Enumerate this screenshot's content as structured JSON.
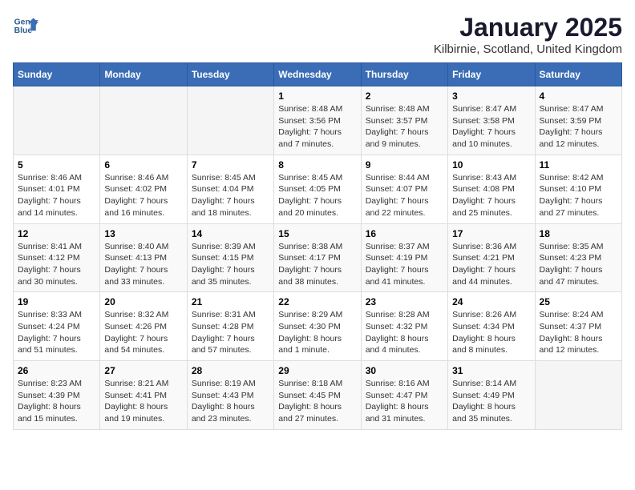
{
  "header": {
    "logo_line1": "General",
    "logo_line2": "Blue",
    "title": "January 2025",
    "subtitle": "Kilbirnie, Scotland, United Kingdom"
  },
  "days_of_week": [
    "Sunday",
    "Monday",
    "Tuesday",
    "Wednesday",
    "Thursday",
    "Friday",
    "Saturday"
  ],
  "weeks": [
    [
      {
        "day": "",
        "info": ""
      },
      {
        "day": "",
        "info": ""
      },
      {
        "day": "",
        "info": ""
      },
      {
        "day": "1",
        "info": "Sunrise: 8:48 AM\nSunset: 3:56 PM\nDaylight: 7 hours\nand 7 minutes."
      },
      {
        "day": "2",
        "info": "Sunrise: 8:48 AM\nSunset: 3:57 PM\nDaylight: 7 hours\nand 9 minutes."
      },
      {
        "day": "3",
        "info": "Sunrise: 8:47 AM\nSunset: 3:58 PM\nDaylight: 7 hours\nand 10 minutes."
      },
      {
        "day": "4",
        "info": "Sunrise: 8:47 AM\nSunset: 3:59 PM\nDaylight: 7 hours\nand 12 minutes."
      }
    ],
    [
      {
        "day": "5",
        "info": "Sunrise: 8:46 AM\nSunset: 4:01 PM\nDaylight: 7 hours\nand 14 minutes."
      },
      {
        "day": "6",
        "info": "Sunrise: 8:46 AM\nSunset: 4:02 PM\nDaylight: 7 hours\nand 16 minutes."
      },
      {
        "day": "7",
        "info": "Sunrise: 8:45 AM\nSunset: 4:04 PM\nDaylight: 7 hours\nand 18 minutes."
      },
      {
        "day": "8",
        "info": "Sunrise: 8:45 AM\nSunset: 4:05 PM\nDaylight: 7 hours\nand 20 minutes."
      },
      {
        "day": "9",
        "info": "Sunrise: 8:44 AM\nSunset: 4:07 PM\nDaylight: 7 hours\nand 22 minutes."
      },
      {
        "day": "10",
        "info": "Sunrise: 8:43 AM\nSunset: 4:08 PM\nDaylight: 7 hours\nand 25 minutes."
      },
      {
        "day": "11",
        "info": "Sunrise: 8:42 AM\nSunset: 4:10 PM\nDaylight: 7 hours\nand 27 minutes."
      }
    ],
    [
      {
        "day": "12",
        "info": "Sunrise: 8:41 AM\nSunset: 4:12 PM\nDaylight: 7 hours\nand 30 minutes."
      },
      {
        "day": "13",
        "info": "Sunrise: 8:40 AM\nSunset: 4:13 PM\nDaylight: 7 hours\nand 33 minutes."
      },
      {
        "day": "14",
        "info": "Sunrise: 8:39 AM\nSunset: 4:15 PM\nDaylight: 7 hours\nand 35 minutes."
      },
      {
        "day": "15",
        "info": "Sunrise: 8:38 AM\nSunset: 4:17 PM\nDaylight: 7 hours\nand 38 minutes."
      },
      {
        "day": "16",
        "info": "Sunrise: 8:37 AM\nSunset: 4:19 PM\nDaylight: 7 hours\nand 41 minutes."
      },
      {
        "day": "17",
        "info": "Sunrise: 8:36 AM\nSunset: 4:21 PM\nDaylight: 7 hours\nand 44 minutes."
      },
      {
        "day": "18",
        "info": "Sunrise: 8:35 AM\nSunset: 4:23 PM\nDaylight: 7 hours\nand 47 minutes."
      }
    ],
    [
      {
        "day": "19",
        "info": "Sunrise: 8:33 AM\nSunset: 4:24 PM\nDaylight: 7 hours\nand 51 minutes."
      },
      {
        "day": "20",
        "info": "Sunrise: 8:32 AM\nSunset: 4:26 PM\nDaylight: 7 hours\nand 54 minutes."
      },
      {
        "day": "21",
        "info": "Sunrise: 8:31 AM\nSunset: 4:28 PM\nDaylight: 7 hours\nand 57 minutes."
      },
      {
        "day": "22",
        "info": "Sunrise: 8:29 AM\nSunset: 4:30 PM\nDaylight: 8 hours\nand 1 minute."
      },
      {
        "day": "23",
        "info": "Sunrise: 8:28 AM\nSunset: 4:32 PM\nDaylight: 8 hours\nand 4 minutes."
      },
      {
        "day": "24",
        "info": "Sunrise: 8:26 AM\nSunset: 4:34 PM\nDaylight: 8 hours\nand 8 minutes."
      },
      {
        "day": "25",
        "info": "Sunrise: 8:24 AM\nSunset: 4:37 PM\nDaylight: 8 hours\nand 12 minutes."
      }
    ],
    [
      {
        "day": "26",
        "info": "Sunrise: 8:23 AM\nSunset: 4:39 PM\nDaylight: 8 hours\nand 15 minutes."
      },
      {
        "day": "27",
        "info": "Sunrise: 8:21 AM\nSunset: 4:41 PM\nDaylight: 8 hours\nand 19 minutes."
      },
      {
        "day": "28",
        "info": "Sunrise: 8:19 AM\nSunset: 4:43 PM\nDaylight: 8 hours\nand 23 minutes."
      },
      {
        "day": "29",
        "info": "Sunrise: 8:18 AM\nSunset: 4:45 PM\nDaylight: 8 hours\nand 27 minutes."
      },
      {
        "day": "30",
        "info": "Sunrise: 8:16 AM\nSunset: 4:47 PM\nDaylight: 8 hours\nand 31 minutes."
      },
      {
        "day": "31",
        "info": "Sunrise: 8:14 AM\nSunset: 4:49 PM\nDaylight: 8 hours\nand 35 minutes."
      },
      {
        "day": "",
        "info": ""
      }
    ]
  ]
}
